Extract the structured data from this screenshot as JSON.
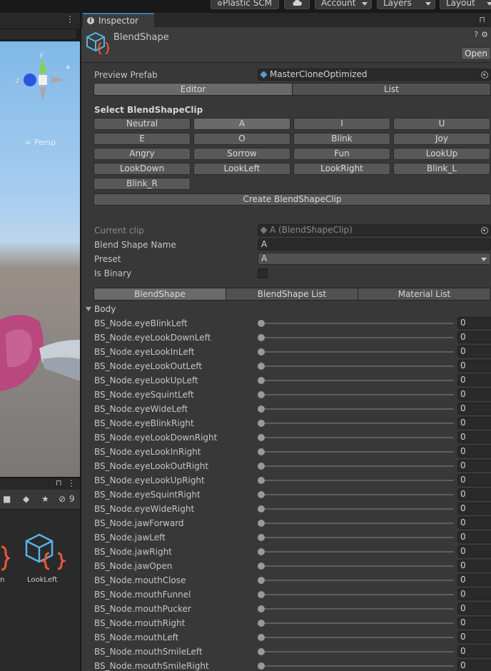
{
  "toolbar": {
    "plastic_scm": "Plastic SCM",
    "account": "Account",
    "layers": "Layers",
    "layout": "Layout"
  },
  "scene": {
    "persp_label": "< Persp",
    "gizmo_y": "y",
    "gizmo_z": "z"
  },
  "project": {
    "hidden_count": "9",
    "asset_label": "LookLeft",
    "asset_label_partial": "n"
  },
  "inspector": {
    "tab_label": "Inspector",
    "title": "BlendShape",
    "open_button": "Open",
    "preview_prefab_label": "Preview Prefab",
    "preview_prefab_value": "MasterCloneOptimized",
    "mode_tabs": [
      "Editor",
      "List"
    ],
    "select_clip_label": "Select BlendShapeClip",
    "clips": [
      "Neutral",
      "A",
      "I",
      "U",
      "E",
      "O",
      "Blink",
      "Joy",
      "Angry",
      "Sorrow",
      "Fun",
      "LookUp",
      "LookDown",
      "LookLeft",
      "LookRight",
      "Blink_L",
      "Blink_R"
    ],
    "selected_clip": "A",
    "create_button": "Create BlendShapeClip",
    "current_clip_label": "Current clip",
    "current_clip_value": "A (BlendShapeClip)",
    "blend_shape_name_label": "Blend Shape Name",
    "blend_shape_name_value": "A",
    "preset_label": "Preset",
    "preset_value": "A",
    "is_binary_label": "Is Binary",
    "is_binary_checked": false,
    "sub_tabs": [
      "BlendShape",
      "BlendShape List",
      "Material List"
    ],
    "foldout_label": "Body",
    "blendshapes": [
      {
        "name": "BS_Node.eyeBlinkLeft",
        "value": "0"
      },
      {
        "name": "BS_Node.eyeLookDownLeft",
        "value": "0"
      },
      {
        "name": "BS_Node.eyeLookInLeft",
        "value": "0"
      },
      {
        "name": "BS_Node.eyeLookOutLeft",
        "value": "0"
      },
      {
        "name": "BS_Node.eyeLookUpLeft",
        "value": "0"
      },
      {
        "name": "BS_Node.eyeSquintLeft",
        "value": "0"
      },
      {
        "name": "BS_Node.eyeWideLeft",
        "value": "0"
      },
      {
        "name": "BS_Node.eyeBlinkRight",
        "value": "0"
      },
      {
        "name": "BS_Node.eyeLookDownRight",
        "value": "0"
      },
      {
        "name": "BS_Node.eyeLookInRight",
        "value": "0"
      },
      {
        "name": "BS_Node.eyeLookOutRight",
        "value": "0"
      },
      {
        "name": "BS_Node.eyeLookUpRight",
        "value": "0"
      },
      {
        "name": "BS_Node.eyeSquintRight",
        "value": "0"
      },
      {
        "name": "BS_Node.eyeWideRight",
        "value": "0"
      },
      {
        "name": "BS_Node.jawForward",
        "value": "0"
      },
      {
        "name": "BS_Node.jawLeft",
        "value": "0"
      },
      {
        "name": "BS_Node.jawRight",
        "value": "0"
      },
      {
        "name": "BS_Node.jawOpen",
        "value": "0"
      },
      {
        "name": "BS_Node.mouthClose",
        "value": "0"
      },
      {
        "name": "BS_Node.mouthFunnel",
        "value": "0"
      },
      {
        "name": "BS_Node.mouthPucker",
        "value": "0"
      },
      {
        "name": "BS_Node.mouthRight",
        "value": "0"
      },
      {
        "name": "BS_Node.mouthLeft",
        "value": "0"
      },
      {
        "name": "BS_Node.mouthSmileLeft",
        "value": "0"
      },
      {
        "name": "BS_Node.mouthSmileRight",
        "value": "0"
      }
    ]
  },
  "colors": {
    "accent_tab": "#3a79bb",
    "icon_cube": "#56b4e8",
    "icon_braces": "#e8583a",
    "panel_bg": "#383838"
  }
}
